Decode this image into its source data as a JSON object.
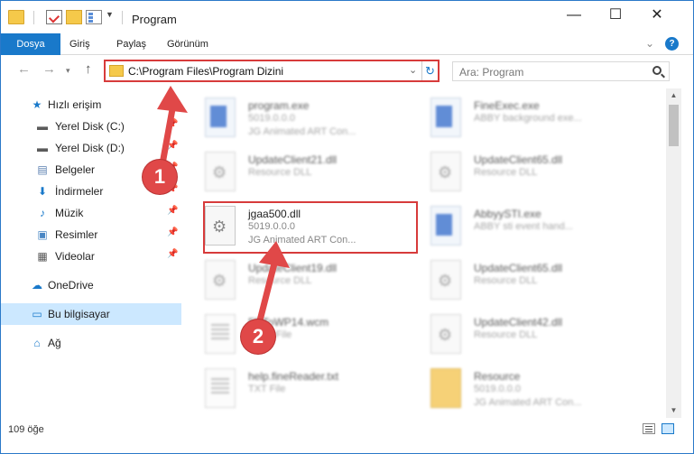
{
  "window": {
    "title": "Program",
    "min_glyph": "—",
    "max_glyph": "☐",
    "close_glyph": "✕"
  },
  "ribbon": {
    "tabs": [
      "Dosya",
      "Giriş",
      "Paylaş",
      "Görünüm"
    ],
    "collapse_glyph": "⌄",
    "help_glyph": "?"
  },
  "nav": {
    "back_glyph": "←",
    "forward_glyph": "→",
    "recent_glyph": "▾",
    "up_glyph": "↑"
  },
  "address": {
    "path": "C:\\Program Files\\Program Dizini",
    "dropdown_glyph": "⌄",
    "refresh_glyph": "↻"
  },
  "search": {
    "placeholder": "Ara: Program"
  },
  "sidebar": {
    "items": [
      {
        "label": "Hızlı erişim",
        "icon": "★",
        "color": "#1979ca"
      },
      {
        "label": "Yerel Disk (C:)",
        "icon": "▬",
        "color": "#5a5a5a"
      },
      {
        "label": "Yerel Disk (D:)",
        "icon": "▬",
        "color": "#5a5a5a"
      },
      {
        "label": "Belgeler",
        "icon": "▤",
        "color": "#5a7fb0"
      },
      {
        "label": "İndirmeler",
        "icon": "⬇",
        "color": "#1979ca"
      },
      {
        "label": "Müzik",
        "icon": "♪",
        "color": "#1979ca"
      },
      {
        "label": "Resimler",
        "icon": "▣",
        "color": "#4a87c4"
      },
      {
        "label": "Videolar",
        "icon": "▦",
        "color": "#555555"
      },
      {
        "label": "OneDrive",
        "icon": "☁",
        "color": "#1979ca"
      },
      {
        "label": "Bu bilgisayar",
        "icon": "▭",
        "color": "#1979ca"
      },
      {
        "label": "Ağ",
        "icon": "⌂",
        "color": "#1979ca"
      }
    ],
    "pin_glyph": "📌"
  },
  "files": [
    {
      "name": "program.exe",
      "line2": "5019.0.0.0",
      "line3": "JG Animated ART Con..."
    },
    {
      "name": "FineExec.exe",
      "line2": "ABBY background exe...",
      "line3": ""
    },
    {
      "name": "UpdateClient21.dll",
      "line2": "Resource DLL",
      "line3": ""
    },
    {
      "name": "UpdateClient65.dll",
      "line2": "Resource DLL",
      "line3": ""
    },
    {
      "name": "jgaa500.dll",
      "line2": "5019.0.0.0",
      "line3": "JG Animated ART Con..."
    },
    {
      "name": "AbbyySTI.exe",
      "line2": "ABBY sti event hand...",
      "line3": ""
    },
    {
      "name": "UpdateClient19.dll",
      "line2": "Resource DLL",
      "line3": ""
    },
    {
      "name": "UpdateClient65.dll",
      "line2": "Resource DLL",
      "line3": ""
    },
    {
      "name": "FRToWP14.wcm",
      "line2": "WCM File",
      "line3": ""
    },
    {
      "name": "UpdateClient42.dll",
      "line2": "Resource DLL",
      "line3": ""
    },
    {
      "name": "help.fineReader.txt",
      "line2": "TXT File",
      "line3": ""
    },
    {
      "name": "Resource",
      "line2": "5019.0.0.0",
      "line3": "JG Animated ART Con..."
    }
  ],
  "status": {
    "item_count": "109 öğe"
  },
  "annotations": {
    "step1": "1",
    "step2": "2",
    "color": "#e04848"
  },
  "scrollbar": {
    "up_glyph": "▲",
    "down_glyph": "▼"
  }
}
